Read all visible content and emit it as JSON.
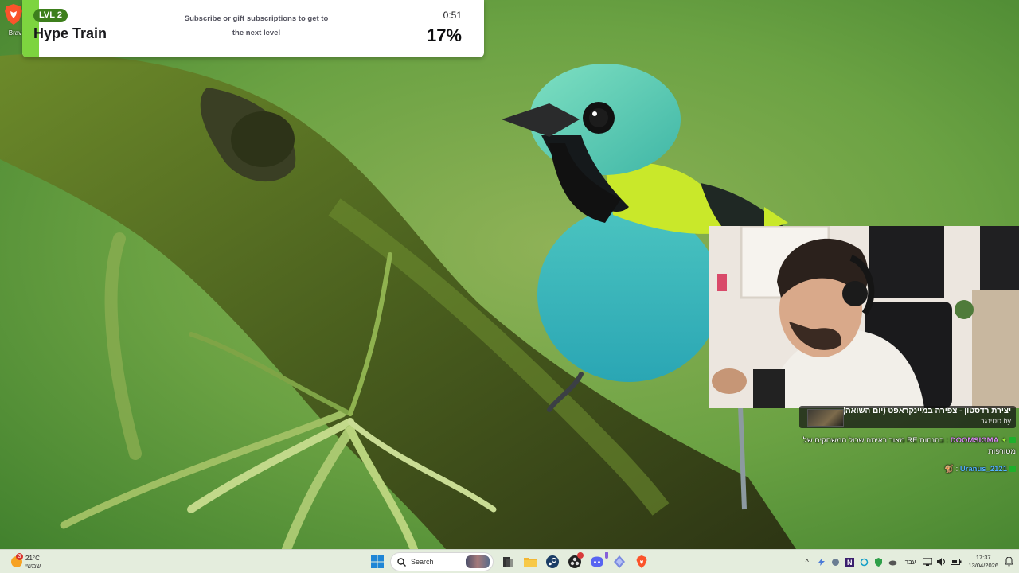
{
  "desktop": {
    "icon_label": "Brav"
  },
  "hype_train": {
    "level": "LVL 2",
    "title": "Hype Train",
    "message": "Subscribe or gift subscriptions to get to the next level",
    "timer": "0:51",
    "percent": "17%",
    "progress_fraction": 0.17,
    "accent_color": "#7dd43f",
    "level_color": "#3d7f1c"
  },
  "chat": {
    "now_playing": {
      "title": "יצירת רדסטון - צפירה במיינקראפט (יום השואה)",
      "byline": "by סטינגר"
    },
    "messages": [
      {
        "user": "DOOMSIGMA",
        "separator": ":",
        "text": "בהנחות RE מאור ראיתה שכול המשחקים של מטורפות"
      },
      {
        "user": "Uranus_2121",
        "separator": ":",
        "text": ""
      }
    ]
  },
  "taskbar": {
    "weather": {
      "badge": "3",
      "temp": "21°C",
      "condition": "שמשי"
    },
    "search_placeholder": "Search",
    "apps": [
      "start-icon",
      "task-view-icon",
      "file-explorer-icon",
      "steam-icon",
      "obs-icon",
      "discord-icon",
      "app-icon",
      "brave-icon"
    ],
    "discord_badge": "",
    "tray": {
      "language": "עבר",
      "time": "17:37",
      "date": "13/04/2026"
    }
  }
}
